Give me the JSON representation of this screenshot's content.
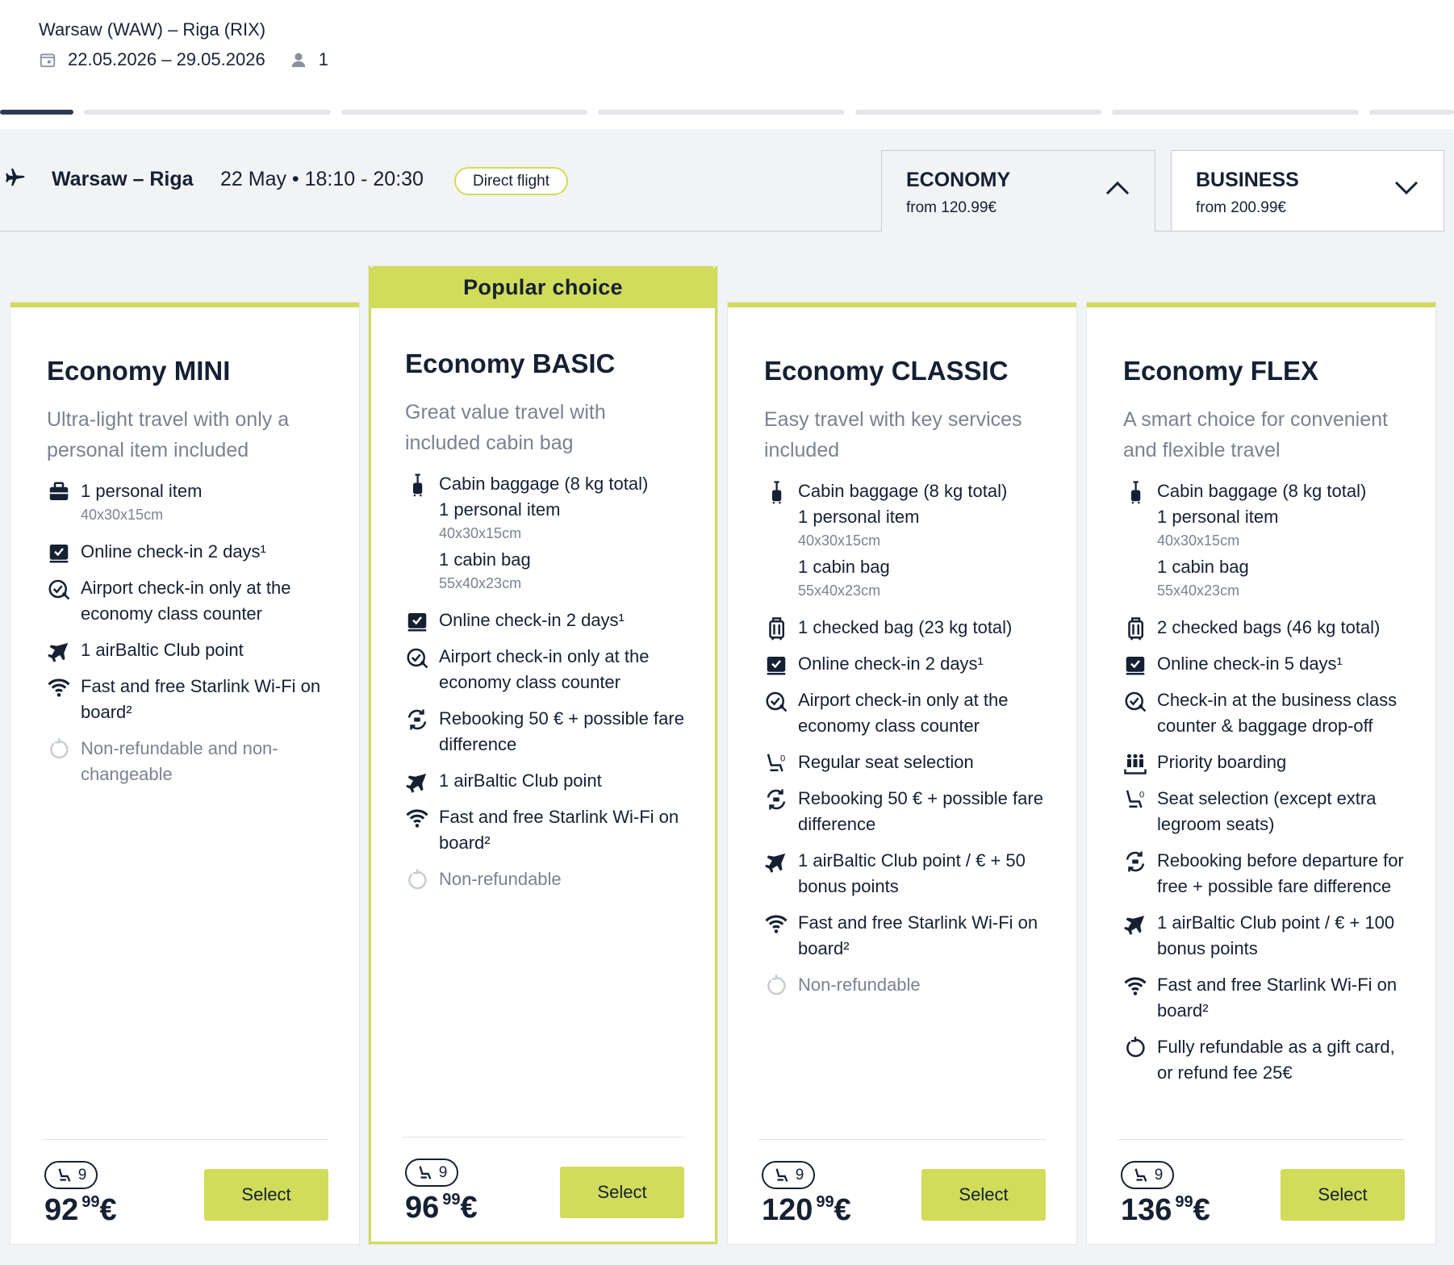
{
  "header": {
    "route": "Warsaw (WAW) – Riga (RIX)",
    "dates": "22.05.2026 – 29.05.2026",
    "passengers": "1"
  },
  "flight": {
    "route": "Warsaw – Riga",
    "time": "22 May • 18:10 - 20:30",
    "badge": "Direct flight"
  },
  "classes": [
    {
      "name": "ECONOMY",
      "price": "from 120.99€",
      "expanded": true
    },
    {
      "name": "BUSINESS",
      "price": "from 200.99€",
      "expanded": false
    }
  ],
  "popular_label": "Popular choice",
  "fares": [
    {
      "title": "Economy MINI",
      "subtitle": "Ultra-light travel with only a personal item included",
      "features": [
        {
          "icon": "briefcase-icon",
          "text": "1 personal item",
          "small": "40x30x15cm"
        },
        {
          "icon": "online-checkin-icon",
          "text": "Online check-in 2 days¹"
        },
        {
          "icon": "airport-checkin-icon",
          "text": "Airport check-in only at the economy class counter"
        },
        {
          "icon": "club-plane-icon",
          "text": "1 airBaltic Club point"
        },
        {
          "icon": "wifi-icon",
          "text": "Fast and free Starlink Wi-Fi on board²"
        },
        {
          "icon": "refund-icon",
          "text": "Non-refundable and non-changeable",
          "muted": true
        }
      ],
      "seats": "9",
      "price_int": "92",
      "price_cents": "99",
      "currency": "€",
      "button": "Select"
    },
    {
      "title": "Economy BASIC",
      "subtitle": "Great value travel with included cabin bag",
      "features": [
        {
          "icon": "cabin-bag-icon",
          "text": "Cabin baggage (8 kg total)",
          "lines": [
            "1 personal item",
            "40x30x15cm",
            "1 cabin bag",
            "55x40x23cm"
          ]
        },
        {
          "icon": "online-checkin-icon",
          "text": "Online check-in 2 days¹"
        },
        {
          "icon": "airport-checkin-icon",
          "text": "Airport check-in only at the economy class counter"
        },
        {
          "icon": "rebooking-icon",
          "text": "Rebooking 50 € + possible fare difference"
        },
        {
          "icon": "club-plane-icon",
          "text": "1 airBaltic Club point"
        },
        {
          "icon": "wifi-icon",
          "text": "Fast and free Starlink Wi-Fi on board²"
        },
        {
          "icon": "refund-icon",
          "text": "Non-refundable",
          "muted": true
        }
      ],
      "seats": "9",
      "price_int": "96",
      "price_cents": "99",
      "currency": "€",
      "button": "Select"
    },
    {
      "title": "Economy CLASSIC",
      "subtitle": "Easy travel with key services included",
      "features": [
        {
          "icon": "cabin-bag-icon",
          "text": "Cabin baggage (8 kg total)",
          "lines": [
            "1 personal item",
            "40x30x15cm",
            "1 cabin bag",
            "55x40x23cm"
          ]
        },
        {
          "icon": "checked-bag-icon",
          "text": "1 checked bag (23 kg total)"
        },
        {
          "icon": "online-checkin-icon",
          "text": "Online check-in 2 days¹"
        },
        {
          "icon": "airport-checkin-icon",
          "text": "Airport check-in only at the economy class counter"
        },
        {
          "icon": "seat-selection-icon",
          "text": "Regular seat selection"
        },
        {
          "icon": "rebooking-icon",
          "text": "Rebooking 50 € + possible fare difference"
        },
        {
          "icon": "club-plane-icon",
          "text": "1 airBaltic Club point / € + 50 bonus points"
        },
        {
          "icon": "wifi-icon",
          "text": "Fast and free Starlink Wi-Fi on board²"
        },
        {
          "icon": "refund-icon",
          "text": "Non-refundable",
          "muted": true
        }
      ],
      "seats": "9",
      "price_int": "120",
      "price_cents": "99",
      "currency": "€",
      "button": "Select"
    },
    {
      "title": "Economy FLEX",
      "subtitle": "A smart choice for convenient and flexible travel",
      "features": [
        {
          "icon": "cabin-bag-icon",
          "text": "Cabin baggage (8 kg total)",
          "lines": [
            "1 personal item",
            "40x30x15cm",
            "1 cabin bag",
            "55x40x23cm"
          ]
        },
        {
          "icon": "checked-bag-icon",
          "text": "2 checked bags (46 kg total)"
        },
        {
          "icon": "online-checkin-icon",
          "text": "Online check-in 5 days¹"
        },
        {
          "icon": "airport-checkin-icon",
          "text": "Check-in at the business class counter & baggage drop-off"
        },
        {
          "icon": "priority-boarding-icon",
          "text": "Priority boarding"
        },
        {
          "icon": "seat-selection-icon",
          "text": "Seat selection (except extra legroom seats)"
        },
        {
          "icon": "rebooking-icon",
          "text": "Rebooking before departure for free + possible fare difference"
        },
        {
          "icon": "club-plane-icon",
          "text": "1 airBaltic Club point / € + 100 bonus points"
        },
        {
          "icon": "wifi-icon",
          "text": "Fast and free Starlink Wi-Fi on board²"
        },
        {
          "icon": "refund-icon",
          "text": "Fully refundable as a gift card, or refund fee 25€"
        }
      ],
      "seats": "9",
      "price_int": "136",
      "price_cents": "99",
      "currency": "€",
      "button": "Select"
    }
  ]
}
